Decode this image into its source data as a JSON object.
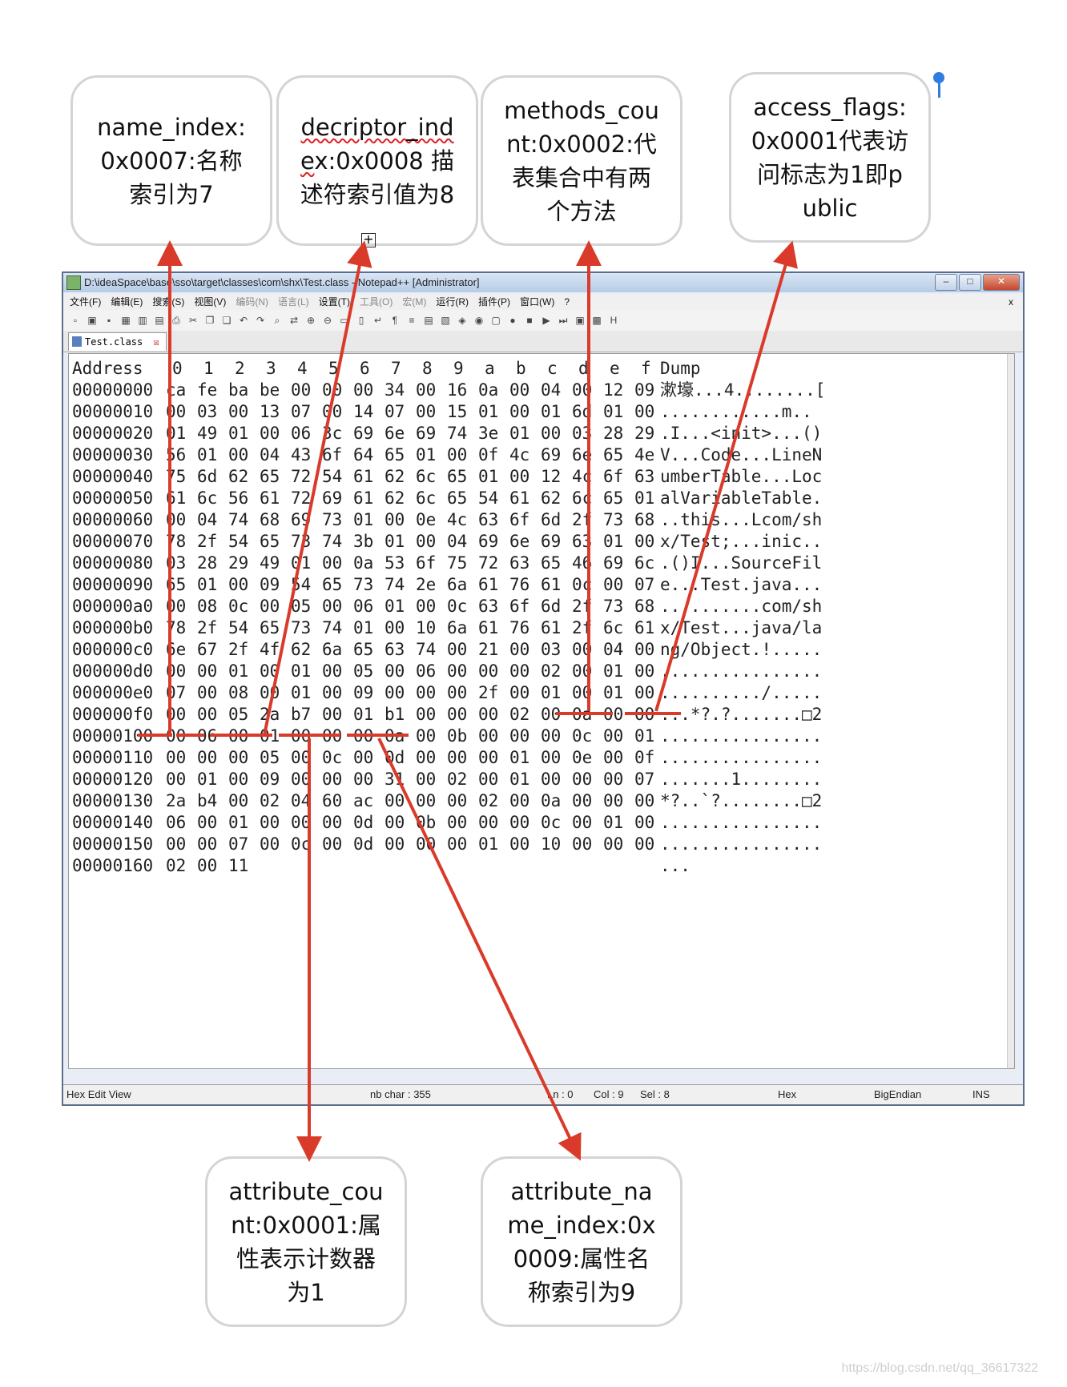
{
  "callouts": {
    "name_index": "name_index:0x0007:名称索引为7",
    "descriptor_pre": "decriptor_inde",
    "descriptor_post": "x:0x0008 描述符索引值为8",
    "methods_count": "methods_count:0x0002:代表集合中有两个方法",
    "access_flags": "access_flags:0x0001代表访问标志为1即public",
    "attribute_count": "attribute_count:0x0001:属性表示计数器为1",
    "attribute_name_index": "attribute_name_index:0x0009:属性名称索引为9"
  },
  "window": {
    "title": "D:\\ideaSpace\\base\\sso\\target\\classes\\com\\shx\\Test.class - Notepad++ [Administrator]",
    "close_glyph": "x",
    "menu": [
      {
        "label": "文件(F)",
        "dim": false
      },
      {
        "label": "编辑(E)",
        "dim": false
      },
      {
        "label": "搜索(S)",
        "dim": false
      },
      {
        "label": "视图(V)",
        "dim": false
      },
      {
        "label": "编码(N)",
        "dim": true
      },
      {
        "label": "语言(L)",
        "dim": true
      },
      {
        "label": "设置(T)",
        "dim": false
      },
      {
        "label": "工具(O)",
        "dim": true
      },
      {
        "label": "宏(M)",
        "dim": true
      },
      {
        "label": "运行(R)",
        "dim": false
      },
      {
        "label": "插件(P)",
        "dim": false
      },
      {
        "label": "窗口(W)",
        "dim": false
      },
      {
        "label": "?",
        "dim": false
      }
    ],
    "tab_label": "Test.class"
  },
  "hex": {
    "header_address": "Address",
    "header_cols": [
      "0",
      "1",
      "2",
      "3",
      "4",
      "5",
      "6",
      "7",
      "8",
      "9",
      "a",
      "b",
      "c",
      "d",
      "e",
      "f"
    ],
    "header_dump": "Dump",
    "rows": [
      {
        "addr": "00000000",
        "bytes": [
          "ca",
          "fe",
          "ba",
          "be",
          "00",
          "00",
          "00",
          "34",
          "00",
          "16",
          "0a",
          "00",
          "04",
          "00",
          "12",
          "09"
        ],
        "dump": "漱壕...4........["
      },
      {
        "addr": "00000010",
        "bytes": [
          "00",
          "03",
          "00",
          "13",
          "07",
          "00",
          "14",
          "07",
          "00",
          "15",
          "01",
          "00",
          "01",
          "6d",
          "01",
          "00"
        ],
        "dump": "............m.."
      },
      {
        "addr": "00000020",
        "bytes": [
          "01",
          "49",
          "01",
          "00",
          "06",
          "3c",
          "69",
          "6e",
          "69",
          "74",
          "3e",
          "01",
          "00",
          "03",
          "28",
          "29"
        ],
        "dump": ".I...<init>...()"
      },
      {
        "addr": "00000030",
        "bytes": [
          "56",
          "01",
          "00",
          "04",
          "43",
          "6f",
          "64",
          "65",
          "01",
          "00",
          "0f",
          "4c",
          "69",
          "6e",
          "65",
          "4e"
        ],
        "dump": "V...Code...LineN"
      },
      {
        "addr": "00000040",
        "bytes": [
          "75",
          "6d",
          "62",
          "65",
          "72",
          "54",
          "61",
          "62",
          "6c",
          "65",
          "01",
          "00",
          "12",
          "4c",
          "6f",
          "63"
        ],
        "dump": "umberTable...Loc"
      },
      {
        "addr": "00000050",
        "bytes": [
          "61",
          "6c",
          "56",
          "61",
          "72",
          "69",
          "61",
          "62",
          "6c",
          "65",
          "54",
          "61",
          "62",
          "6c",
          "65",
          "01"
        ],
        "dump": "alVariableTable."
      },
      {
        "addr": "00000060",
        "bytes": [
          "00",
          "04",
          "74",
          "68",
          "69",
          "73",
          "01",
          "00",
          "0e",
          "4c",
          "63",
          "6f",
          "6d",
          "2f",
          "73",
          "68"
        ],
        "dump": "..this...Lcom/sh"
      },
      {
        "addr": "00000070",
        "bytes": [
          "78",
          "2f",
          "54",
          "65",
          "73",
          "74",
          "3b",
          "01",
          "00",
          "04",
          "69",
          "6e",
          "69",
          "63",
          "01",
          "00"
        ],
        "dump": "x/Test;...inic.."
      },
      {
        "addr": "00000080",
        "bytes": [
          "03",
          "28",
          "29",
          "49",
          "01",
          "00",
          "0a",
          "53",
          "6f",
          "75",
          "72",
          "63",
          "65",
          "46",
          "69",
          "6c"
        ],
        "dump": ".()I...SourceFil"
      },
      {
        "addr": "00000090",
        "bytes": [
          "65",
          "01",
          "00",
          "09",
          "54",
          "65",
          "73",
          "74",
          "2e",
          "6a",
          "61",
          "76",
          "61",
          "0c",
          "00",
          "07"
        ],
        "dump": "e...Test.java..."
      },
      {
        "addr": "000000a0",
        "bytes": [
          "00",
          "08",
          "0c",
          "00",
          "05",
          "00",
          "06",
          "01",
          "00",
          "0c",
          "63",
          "6f",
          "6d",
          "2f",
          "73",
          "68"
        ],
        "dump": "..........com/sh"
      },
      {
        "addr": "000000b0",
        "bytes": [
          "78",
          "2f",
          "54",
          "65",
          "73",
          "74",
          "01",
          "00",
          "10",
          "6a",
          "61",
          "76",
          "61",
          "2f",
          "6c",
          "61"
        ],
        "dump": "x/Test...java/la"
      },
      {
        "addr": "000000c0",
        "bytes": [
          "6e",
          "67",
          "2f",
          "4f",
          "62",
          "6a",
          "65",
          "63",
          "74",
          "00",
          "21",
          "00",
          "03",
          "00",
          "04",
          "00"
        ],
        "dump": "ng/Object.!....."
      },
      {
        "addr": "000000d0",
        "bytes": [
          "00",
          "00",
          "01",
          "00",
          "01",
          "00",
          "05",
          "00",
          "06",
          "00",
          "00",
          "00",
          "02",
          "00",
          "01",
          "00"
        ],
        "dump": "................"
      },
      {
        "addr": "000000e0",
        "bytes": [
          "07",
          "00",
          "08",
          "00",
          "01",
          "00",
          "09",
          "00",
          "00",
          "00",
          "2f",
          "00",
          "01",
          "00",
          "01",
          "00"
        ],
        "dump": "........../....."
      },
      {
        "addr": "000000f0",
        "bytes": [
          "00",
          "00",
          "05",
          "2a",
          "b7",
          "00",
          "01",
          "b1",
          "00",
          "00",
          "00",
          "02",
          "00",
          "0a",
          "00",
          "00"
        ],
        "dump": "...*?.?.......□2"
      },
      {
        "addr": "00000100",
        "bytes": [
          "00",
          "06",
          "00",
          "01",
          "00",
          "00",
          "00",
          "0a",
          "00",
          "0b",
          "00",
          "00",
          "00",
          "0c",
          "00",
          "01"
        ],
        "dump": "................"
      },
      {
        "addr": "00000110",
        "bytes": [
          "00",
          "00",
          "00",
          "05",
          "00",
          "0c",
          "00",
          "0d",
          "00",
          "00",
          "00",
          "01",
          "00",
          "0e",
          "00",
          "0f"
        ],
        "dump": "................"
      },
      {
        "addr": "00000120",
        "bytes": [
          "00",
          "01",
          "00",
          "09",
          "00",
          "00",
          "00",
          "31",
          "00",
          "02",
          "00",
          "01",
          "00",
          "00",
          "00",
          "07"
        ],
        "dump": ".......1........"
      },
      {
        "addr": "00000130",
        "bytes": [
          "2a",
          "b4",
          "00",
          "02",
          "04",
          "60",
          "ac",
          "00",
          "00",
          "00",
          "02",
          "00",
          "0a",
          "00",
          "00",
          "00"
        ],
        "dump": "*?..`?........□2"
      },
      {
        "addr": "00000140",
        "bytes": [
          "06",
          "00",
          "01",
          "00",
          "00",
          "00",
          "0d",
          "00",
          "0b",
          "00",
          "00",
          "00",
          "0c",
          "00",
          "01",
          "00"
        ],
        "dump": "................"
      },
      {
        "addr": "00000150",
        "bytes": [
          "00",
          "00",
          "07",
          "00",
          "0c",
          "00",
          "0d",
          "00",
          "00",
          "00",
          "01",
          "00",
          "10",
          "00",
          "00",
          "00"
        ],
        "dump": "................"
      },
      {
        "addr": "00000160",
        "bytes": [
          "02",
          "00",
          "11"
        ],
        "dump": "..."
      }
    ]
  },
  "status": {
    "view": "Hex Edit View",
    "nb_char": "nb char : 355",
    "ln": "Ln : 0",
    "col": "Col : 9",
    "sel": "Sel : 8",
    "mode": "Hex",
    "endian": "BigEndian",
    "ins": "INS"
  },
  "watermark": "https://blog.csdn.net/qq_36617322",
  "colors": {
    "accent_red": "#d93a2a",
    "pin_blue": "#2f7de1"
  }
}
